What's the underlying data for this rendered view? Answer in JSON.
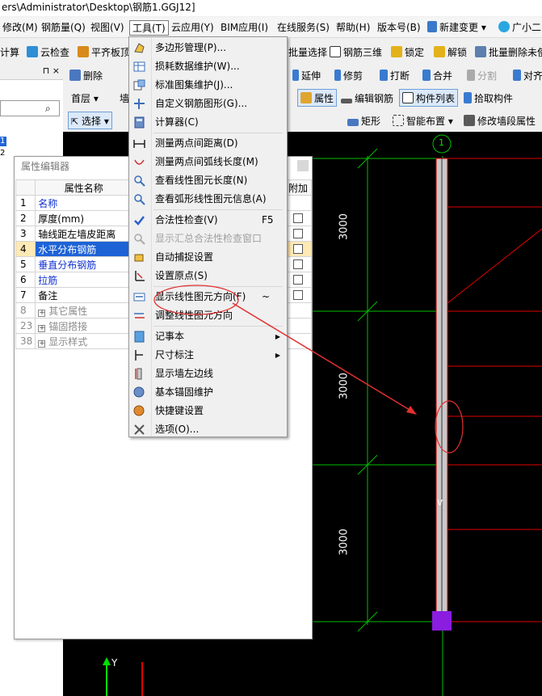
{
  "titlebar": {
    "path": "ers\\Administrator\\Desktop\\钢筋1.GGJ12]"
  },
  "menubar": {
    "items": [
      "修改(M)",
      "钢筋量(Q)",
      "视图(V)",
      "工具(T)",
      "云应用(Y)",
      "BIM应用(I)",
      "在线服务(S)",
      "帮助(H)",
      "版本号(B)",
      "新建变更",
      "广小二"
    ]
  },
  "toolbar1": {
    "items": [
      "计算",
      "云检查",
      "平齐板顶",
      "批量选择",
      "钢筋三维",
      "锁定",
      "解锁",
      "批量删除未使"
    ]
  },
  "toolbar2": {
    "items": [
      "删除",
      "延伸",
      "修剪",
      "打断",
      "合并",
      "分割",
      "对齐"
    ]
  },
  "toolbar3": {
    "floor": "首层",
    "floor2": "墙",
    "items": [
      "属性",
      "编辑钢筋",
      "构件列表",
      "拾取构件"
    ]
  },
  "toolbar4": {
    "select": "选择",
    "items": [
      "矩形",
      "智能布置",
      "修改墙段属性"
    ]
  },
  "tools_menu": {
    "items": [
      {
        "label": "多边形管理(P)...",
        "icon": "polygon-icon"
      },
      {
        "label": "损耗数据维护(W)...",
        "icon": "table-icon"
      },
      {
        "label": "标准图集维护(J)...",
        "icon": "atlas-icon"
      },
      {
        "label": "自定义钢筋图形(G)...",
        "icon": "custom-rebar-icon"
      },
      {
        "label": "计算器(C)",
        "icon": "calculator-icon"
      },
      {
        "label": "测量两点间距离(D)",
        "icon": "measure-distance-icon"
      },
      {
        "label": "测量两点间弧线长度(M)",
        "icon": "measure-arc-icon"
      },
      {
        "label": "查看线性图元长度(N)",
        "icon": "view-length-icon"
      },
      {
        "label": "查看弧形线性图元信息(A)",
        "icon": "view-arc-icon"
      },
      {
        "label": "合法性检查(V)",
        "shortcut": "F5",
        "icon": "check-icon"
      },
      {
        "label": "显示汇总合法性检查窗口",
        "disabled": true,
        "icon": "search-icon"
      },
      {
        "label": "自动捕捉设置",
        "icon": "snap-icon"
      },
      {
        "label": "设置原点(S)",
        "icon": "origin-icon"
      },
      {
        "label": "显示线性图元方向(F)",
        "shortcut": "~",
        "icon": "direction-icon"
      },
      {
        "label": "调整线性图元方向",
        "icon": "adjust-direction-icon"
      },
      {
        "label": "记事本",
        "submenu": true,
        "icon": "notepad-icon"
      },
      {
        "label": "尺寸标注",
        "submenu": true,
        "icon": "dimension-icon"
      },
      {
        "label": "显示墙左边线",
        "icon": "wall-edge-icon"
      },
      {
        "label": "基本锚固维护",
        "icon": "anchor-icon"
      },
      {
        "label": "快捷键设置",
        "icon": "shortcut-icon"
      },
      {
        "label": "选项(O)...",
        "icon": "options-icon"
      }
    ]
  },
  "prop_editor": {
    "title": "属性编辑器",
    "header": {
      "name": "属性名称",
      "extra": "附加"
    },
    "rows": [
      {
        "num": "1",
        "name": "名称",
        "blue": true
      },
      {
        "num": "2",
        "name": "厚度(mm)"
      },
      {
        "num": "3",
        "name": "轴线距左墙皮距离"
      },
      {
        "num": "4",
        "name": "水平分布钢筋",
        "blue": true,
        "selected": true
      },
      {
        "num": "5",
        "name": "垂直分布钢筋",
        "blue": true
      },
      {
        "num": "6",
        "name": "拉筋",
        "blue": true
      },
      {
        "num": "7",
        "name": "备注"
      },
      {
        "num": "8",
        "name": "其它属性",
        "group": true
      },
      {
        "num": "23",
        "name": "锚固搭接",
        "group": true
      },
      {
        "num": "38",
        "name": "显示样式",
        "group": true
      }
    ]
  },
  "left_panel": {
    "pin": "⊓ ×",
    "nums": [
      "1",
      "2"
    ]
  },
  "canvas": {
    "axis_label": "1",
    "dims": [
      "3000",
      "3000",
      "3000"
    ],
    "y_axis": "Y"
  },
  "colors": {
    "accent_select": "#1e63d6",
    "grid_green": "#00c000",
    "grid_red": "#e00000",
    "annotation_red": "#e23030"
  }
}
